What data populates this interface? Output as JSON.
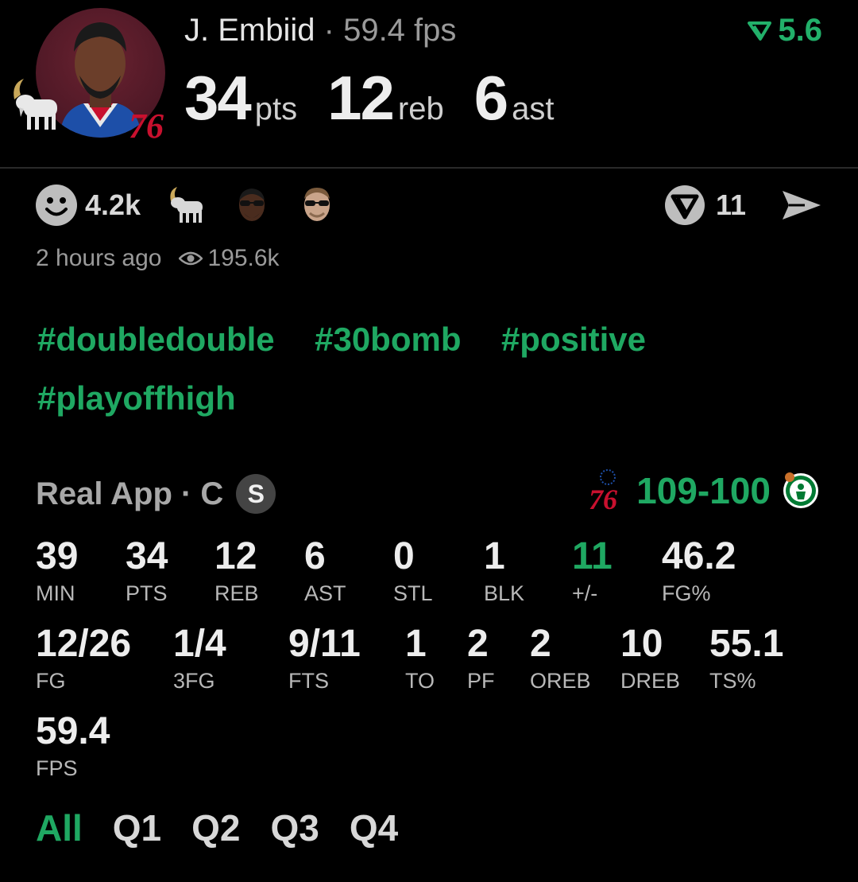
{
  "header": {
    "player_name": "J. Embiid",
    "separator": "·",
    "fps_text": "59.4 fps",
    "trend_value": "5.6",
    "stats": [
      {
        "value": "34",
        "unit": "pts"
      },
      {
        "value": "12",
        "unit": "reb"
      },
      {
        "value": "6",
        "unit": "ast"
      }
    ],
    "team_logo_text": "76"
  },
  "reactions": {
    "count": "4.2k",
    "comments": "11",
    "time_ago": "2 hours ago",
    "views": "195.6k"
  },
  "hashtags": [
    "#doubledouble",
    "#30bomb",
    "#positive",
    "#playoffhigh"
  ],
  "game": {
    "source": "Real App · C",
    "badge": "S",
    "home_logo_text": "76",
    "score": "109-100"
  },
  "stats_grid": {
    "row1": [
      {
        "value": "39",
        "label": "MIN"
      },
      {
        "value": "34",
        "label": "PTS"
      },
      {
        "value": "12",
        "label": "REB"
      },
      {
        "value": "6",
        "label": "AST"
      },
      {
        "value": "0",
        "label": "STL"
      },
      {
        "value": "1",
        "label": "BLK"
      },
      {
        "value": "11",
        "label": "+/-"
      },
      {
        "value": "46.2",
        "label": "FG%"
      }
    ],
    "row2": [
      {
        "value": "12/26",
        "label": "FG"
      },
      {
        "value": "1/4",
        "label": "3FG"
      },
      {
        "value": "9/11",
        "label": "FTS"
      },
      {
        "value": "1",
        "label": "TO"
      },
      {
        "value": "2",
        "label": "PF"
      },
      {
        "value": "2",
        "label": "OREB"
      },
      {
        "value": "10",
        "label": "DREB"
      },
      {
        "value": "55.1",
        "label": "TS%"
      }
    ],
    "row3": [
      {
        "value": "59.4",
        "label": "FPS"
      }
    ]
  },
  "tabs": [
    "All",
    "Q1",
    "Q2",
    "Q3",
    "Q4"
  ],
  "colors": {
    "accent": "#1fa862",
    "background": "#000000"
  }
}
